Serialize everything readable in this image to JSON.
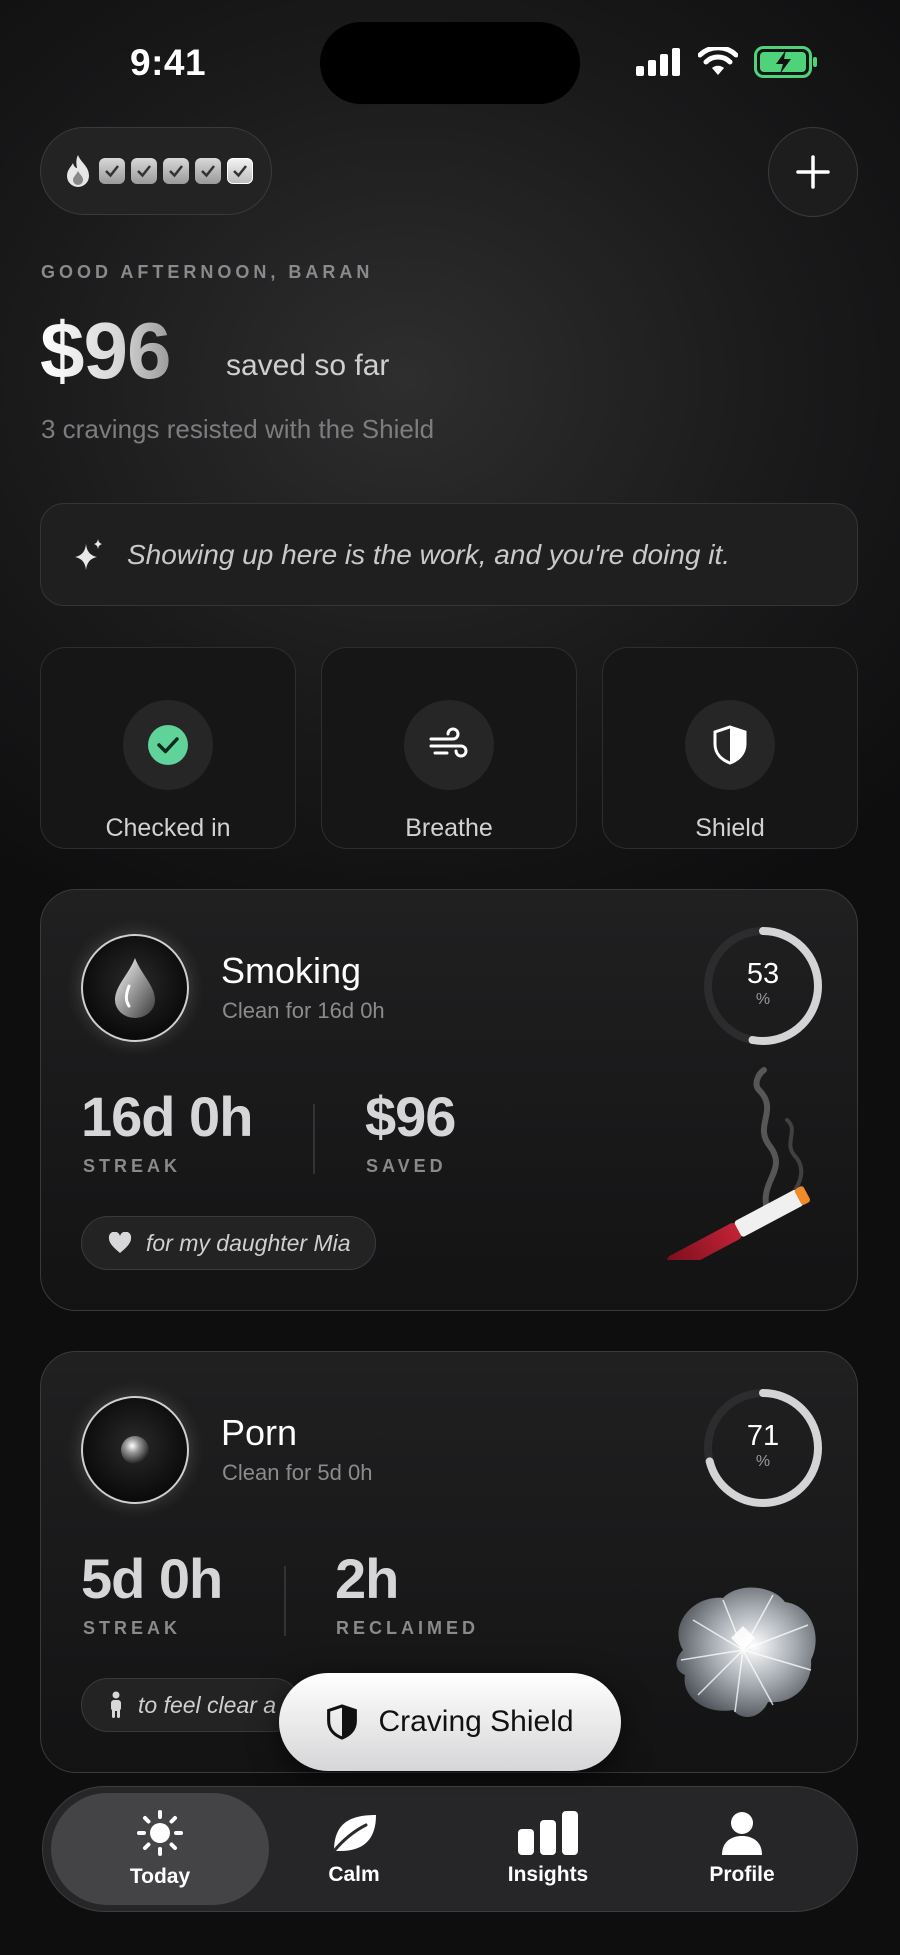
{
  "status_bar": {
    "time": "9:41"
  },
  "header": {
    "streak_days": 5,
    "greeting": "GOOD AFTERNOON, BARAN",
    "amount": "$96",
    "amount_suffix": "saved so far",
    "resisted": "3 cravings resisted with the Shield"
  },
  "quote": {
    "text": "Showing up here is the work, and you're doing it."
  },
  "quick_actions": [
    {
      "label": "Checked in",
      "icon": "checkmark-circle-icon",
      "accent": "#5fd39a"
    },
    {
      "label": "Breathe",
      "icon": "wind-icon"
    },
    {
      "label": "Shield",
      "icon": "shield-icon"
    }
  ],
  "habits": [
    {
      "title": "Smoking",
      "subtitle": "Clean for 16d 0h",
      "streak_value": "16d 0h",
      "streak_label": "STREAK",
      "second_value": "$96",
      "second_label": "SAVED",
      "progress_label": "53",
      "progress_unit": "%",
      "progress": 0.53,
      "motive": "for my daughter Mia",
      "motive_icon": "heart-icon",
      "illustration": "cigarette-illustration"
    },
    {
      "title": "Porn",
      "subtitle": "Clean for 5d 0h",
      "streak_value": "5d 0h",
      "streak_label": "STREAK",
      "second_value": "2h",
      "second_label": "RECLAIMED",
      "progress_label": "71",
      "progress_unit": "%",
      "progress": 0.71,
      "motive": "to feel clear a",
      "motive_icon": "person-icon",
      "illustration": "crystal-brain-illustration"
    }
  ],
  "craving_shield": {
    "label": "Craving Shield"
  },
  "tabs": [
    {
      "label": "Today",
      "icon": "sun-icon",
      "active": true
    },
    {
      "label": "Calm",
      "icon": "leaf-icon",
      "active": false
    },
    {
      "label": "Insights",
      "icon": "bar-chart-icon",
      "active": false
    },
    {
      "label": "Profile",
      "icon": "person-icon",
      "active": false
    }
  ]
}
